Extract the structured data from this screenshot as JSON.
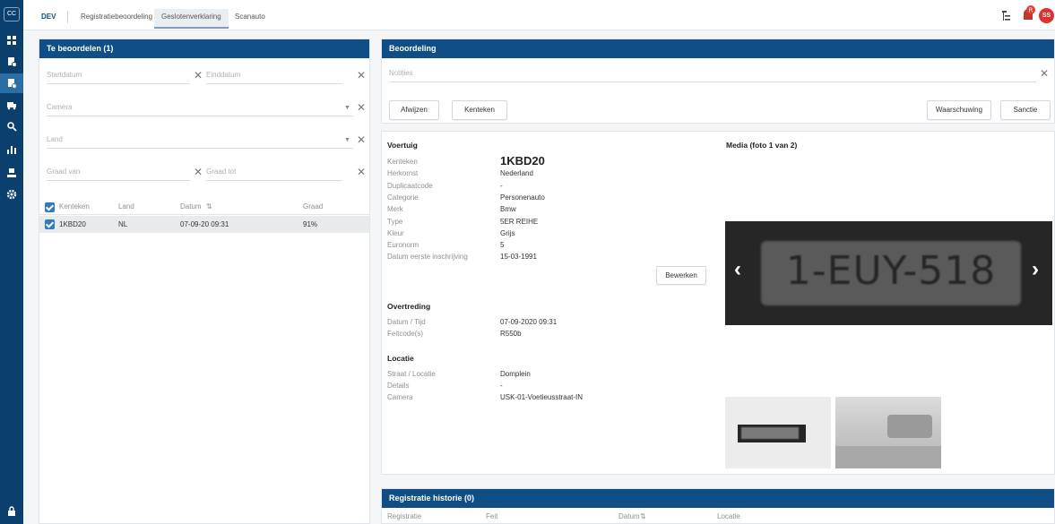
{
  "rail": {
    "logo": "CC",
    "items": [
      "dashboard-icon",
      "documents-icon",
      "document-active-icon",
      "truck-icon",
      "search-user-icon",
      "chart-icon",
      "user-icon",
      "settings-icon"
    ],
    "lock": "lock-icon"
  },
  "tabs": [
    "DEV",
    "Registratiebeoordeling",
    "Geslotenverklaring",
    "Scanauto"
  ],
  "header": {
    "avatar": "SS",
    "badge": "R"
  },
  "left": {
    "title": "Te beoordelen (1)",
    "startdatum": "Startdatum",
    "einddatum": "Einddatum",
    "camera": "Camera",
    "land": "Land",
    "graad_van": "Graad van",
    "graad_tot": "Graad tot",
    "columns": [
      "Kenteken",
      "Land",
      "Datum",
      "Graad"
    ],
    "rows": [
      {
        "kenteken": "1KBD20",
        "land": "NL",
        "datum": "07-09-20 09:31",
        "graad": "91%"
      }
    ]
  },
  "beoordeling": {
    "title": "Beoordeling",
    "notities": "Notities",
    "afwijzen": "Afwijzen",
    "kenteken": "Kenteken",
    "waarschuwing": "Waarschuwing",
    "sanctie": "Sanctie"
  },
  "voertuig": {
    "title": "Voertuig",
    "plate": "1KBD20",
    "labels": [
      "Kenteken",
      "Herkomst",
      "Duplicaatcode",
      "Categorie",
      "Merk",
      "Type",
      "Kleur",
      "Euronorm",
      "Datum eerste inschrijving"
    ],
    "values": [
      "",
      "Nederland",
      "-",
      "Personenauto",
      "Bmw",
      "5ER REIHE",
      "Grijs",
      "5",
      "15-03-1991"
    ],
    "bewerken": "Bewerken"
  },
  "overtreding": {
    "title": "Overtreding",
    "labels": [
      "Datum / Tijd",
      "Feitcode(s)"
    ],
    "values": [
      "07-09-2020 09:31",
      "R550b"
    ]
  },
  "locatie": {
    "title": "Locatie",
    "labels": [
      "Straat / Locatie",
      "Details",
      "Camera"
    ],
    "values": [
      "Domplein",
      "-",
      "USK-01-Voetieusstraat-IN"
    ]
  },
  "media": {
    "title": "Media (foto 1 van 2)",
    "plate_text": "1-EUY-518"
  },
  "historie": {
    "title": "Registratie historie (0)",
    "columns": [
      "Registratie",
      "Feit",
      "Datum",
      "Locatie"
    ]
  }
}
